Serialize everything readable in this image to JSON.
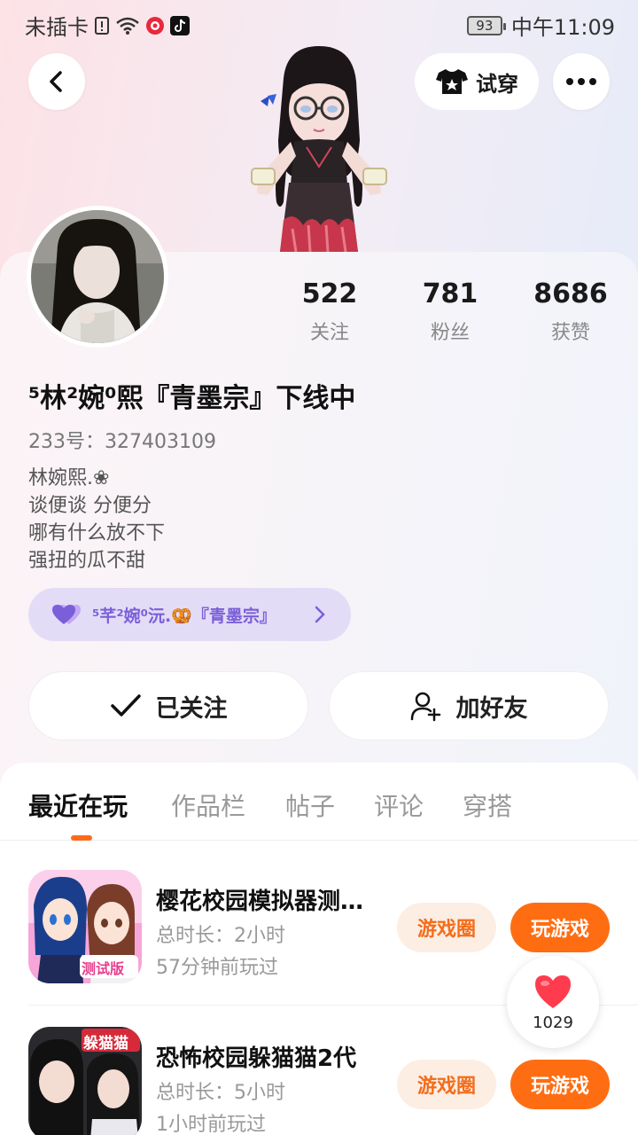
{
  "status_bar": {
    "carrier": "未插卡",
    "battery": "93",
    "time": "中午11:09"
  },
  "header": {
    "try_on_label": "试穿"
  },
  "profile": {
    "stats": [
      {
        "value": "522",
        "label": "关注"
      },
      {
        "value": "781",
        "label": "粉丝"
      },
      {
        "value": "8686",
        "label": "获赞"
      }
    ],
    "nickname": "⁵林²婉⁰熙『青墨宗』下线中",
    "uid": "233号：327403109",
    "bio": [
      "林婉熙.❀",
      "谈便谈  分便分",
      "哪有什么放不下",
      "强扭的瓜不甜"
    ],
    "guild": "⁵芊²婉⁰沅.🥨『青墨宗』",
    "follow_label": "已关注",
    "add_friend_label": "加好友"
  },
  "tabs": [
    "最近在玩",
    "作品栏",
    "帖子",
    "评论",
    "穿搭"
  ],
  "games": [
    {
      "title": "樱花校园模拟器测试版",
      "duration": "总时长：2小时",
      "last_played": "57分钟前玩过",
      "icon_badge": "测试版",
      "circle_label": "游戏圈",
      "play_label": "玩游戏"
    },
    {
      "title": "恐怖校园躲猫猫2代",
      "duration": "总时长：5小时",
      "last_played": "1小时前玩过",
      "icon_badge": "躲猫猫",
      "circle_label": "游戏圈",
      "play_label": "玩游戏"
    }
  ],
  "like_float": {
    "count": "1029"
  },
  "colors": {
    "accent": "#ff6d12",
    "guild_purple": "#7a5fd9",
    "like_red": "#ff3b4e"
  }
}
